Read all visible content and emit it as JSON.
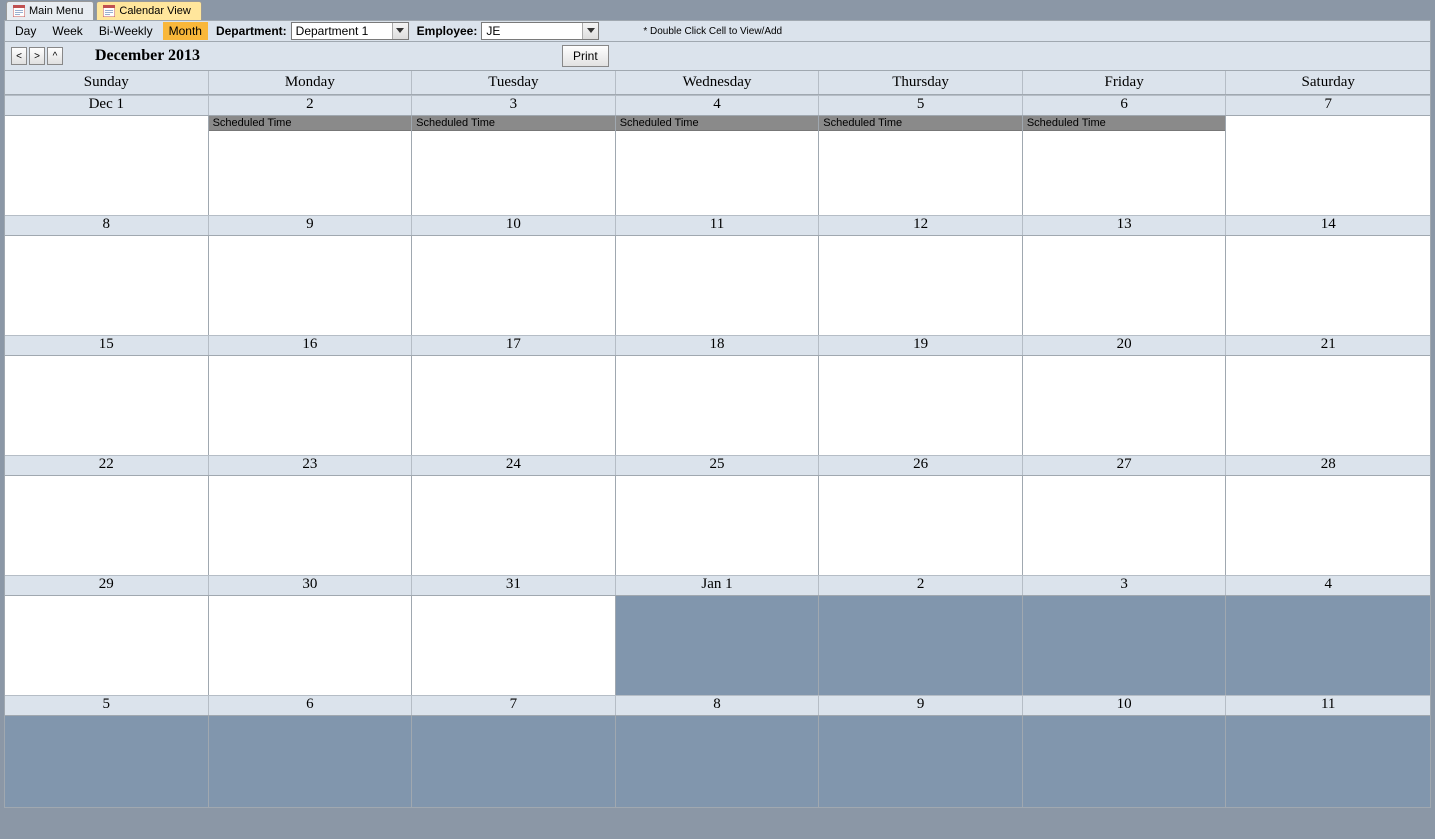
{
  "tabs": [
    {
      "label": "Main Menu",
      "active": false
    },
    {
      "label": "Calendar View",
      "active": true
    }
  ],
  "toolbar": {
    "views": [
      "Day",
      "Week",
      "Bi-Weekly",
      "Month"
    ],
    "active_view": "Month",
    "dept_label": "Department:",
    "dept_value": "Department 1",
    "emp_label": "Employee:",
    "emp_value": "JE",
    "hint": "* Double Click Cell to View/Add"
  },
  "nav": {
    "prev": "<",
    "next": ">",
    "today": "^",
    "title": "December 2013",
    "print": "Print"
  },
  "day_headers": [
    "Sunday",
    "Monday",
    "Tuesday",
    "Wednesday",
    "Thursday",
    "Friday",
    "Saturday"
  ],
  "weeks": [
    {
      "dates": [
        "Dec 1",
        "2",
        "3",
        "4",
        "5",
        "6",
        "7"
      ],
      "cells": [
        {
          "other": false,
          "events": []
        },
        {
          "other": false,
          "events": [
            "Scheduled Time"
          ]
        },
        {
          "other": false,
          "events": [
            "Scheduled Time"
          ]
        },
        {
          "other": false,
          "events": [
            "Scheduled Time"
          ]
        },
        {
          "other": false,
          "events": [
            "Scheduled Time"
          ]
        },
        {
          "other": false,
          "events": [
            "Scheduled Time"
          ]
        },
        {
          "other": false,
          "events": []
        }
      ]
    },
    {
      "dates": [
        "8",
        "9",
        "10",
        "11",
        "12",
        "13",
        "14"
      ],
      "cells": [
        {
          "other": false
        },
        {
          "other": false
        },
        {
          "other": false
        },
        {
          "other": false
        },
        {
          "other": false
        },
        {
          "other": false
        },
        {
          "other": false
        }
      ]
    },
    {
      "dates": [
        "15",
        "16",
        "17",
        "18",
        "19",
        "20",
        "21"
      ],
      "cells": [
        {
          "other": false
        },
        {
          "other": false
        },
        {
          "other": false
        },
        {
          "other": false
        },
        {
          "other": false
        },
        {
          "other": false
        },
        {
          "other": false
        }
      ]
    },
    {
      "dates": [
        "22",
        "23",
        "24",
        "25",
        "26",
        "27",
        "28"
      ],
      "cells": [
        {
          "other": false
        },
        {
          "other": false
        },
        {
          "other": false
        },
        {
          "other": false
        },
        {
          "other": false
        },
        {
          "other": false
        },
        {
          "other": false
        }
      ]
    },
    {
      "dates": [
        "29",
        "30",
        "31",
        "Jan 1",
        "2",
        "3",
        "4"
      ],
      "cells": [
        {
          "other": false
        },
        {
          "other": false
        },
        {
          "other": false
        },
        {
          "other": true
        },
        {
          "other": true
        },
        {
          "other": true
        },
        {
          "other": true
        }
      ]
    },
    {
      "dates": [
        "5",
        "6",
        "7",
        "8",
        "9",
        "10",
        "11"
      ],
      "cells": [
        {
          "other": true
        },
        {
          "other": true
        },
        {
          "other": true
        },
        {
          "other": true
        },
        {
          "other": true
        },
        {
          "other": true
        },
        {
          "other": true
        }
      ]
    }
  ]
}
